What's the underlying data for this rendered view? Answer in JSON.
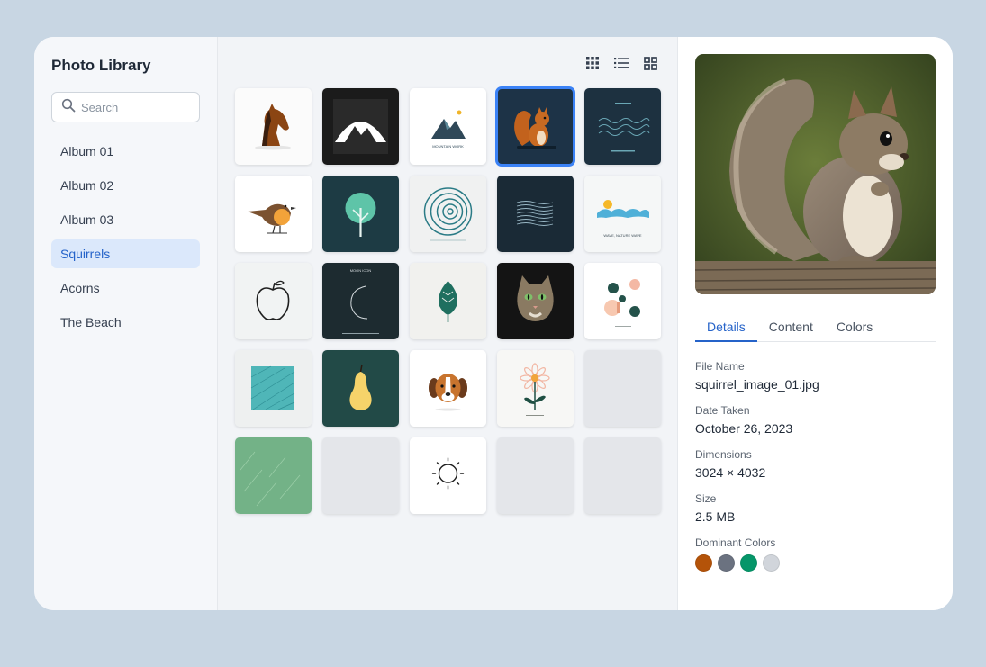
{
  "sidebar": {
    "title": "Photo Library",
    "search_placeholder": "Search",
    "albums": [
      {
        "label": "Album 01",
        "active": false
      },
      {
        "label": "Album 02",
        "active": false
      },
      {
        "label": "Album 03",
        "active": false
      },
      {
        "label": "Squirrels",
        "active": true
      },
      {
        "label": "Acorns",
        "active": false
      },
      {
        "label": "The Beach",
        "active": false
      }
    ]
  },
  "toolbar": {
    "icons": [
      "grid-small-icon",
      "list-icon",
      "grid-large-icon"
    ]
  },
  "grid": {
    "thumbnails": [
      {
        "name": "horse-thumbnail",
        "caption": ""
      },
      {
        "name": "mountain-arch-thumbnail",
        "caption": ""
      },
      {
        "name": "mountain-work-thumbnail",
        "caption": "MOUNTAIN WORK"
      },
      {
        "name": "squirrel-thumbnail",
        "caption": "",
        "selected": true
      },
      {
        "name": "waves-dark-thumbnail",
        "caption": ""
      },
      {
        "name": "bird-thumbnail",
        "caption": ""
      },
      {
        "name": "tree-thumbnail",
        "caption": ""
      },
      {
        "name": "spiral-thumbnail",
        "caption": ""
      },
      {
        "name": "wave-pattern-thumbnail",
        "caption": ""
      },
      {
        "name": "wave-nature-thumbnail",
        "caption": "WAVE, NATURE WAVE"
      },
      {
        "name": "apple-thumbnail",
        "caption": ""
      },
      {
        "name": "moon-icon-thumbnail",
        "caption": "MOON ICON"
      },
      {
        "name": "leaf-thumbnail",
        "caption": ""
      },
      {
        "name": "cat-thumbnail",
        "caption": ""
      },
      {
        "name": "abstract-circles-thumbnail",
        "caption": ""
      },
      {
        "name": "teal-texture-thumbnail",
        "caption": ""
      },
      {
        "name": "pear-thumbnail",
        "caption": ""
      },
      {
        "name": "dog-thumbnail",
        "caption": ""
      },
      {
        "name": "flower-thumbnail",
        "caption": ""
      },
      {
        "name": "empty-thumbnail",
        "caption": ""
      },
      {
        "name": "green-rain-thumbnail",
        "caption": ""
      },
      {
        "name": "empty-thumbnail",
        "caption": ""
      },
      {
        "name": "sun-thumbnail",
        "caption": ""
      },
      {
        "name": "empty-thumbnail",
        "caption": ""
      },
      {
        "name": "empty-thumbnail",
        "caption": ""
      }
    ]
  },
  "detail": {
    "tabs": [
      {
        "label": "Details",
        "active": true
      },
      {
        "label": "Content",
        "active": false
      },
      {
        "label": "Colors",
        "active": false
      }
    ],
    "file_name_label": "File Name",
    "file_name": "squirrel_image_01.jpg",
    "date_label": "Date Taken",
    "date": "October 26, 2023",
    "dimensions_label": "Dimensions",
    "dimensions": "3024 × 4032",
    "size_label": "Size",
    "size": "2.5 MB",
    "dominant_colors_label": "Dominant Colors",
    "dominant_colors": [
      "#b45309",
      "#6b7280",
      "#059669",
      "#d1d5db"
    ]
  },
  "colors": {
    "accent": "#2563c9",
    "active_album_bg": "#dbe8fb",
    "selection": "#3b82f6",
    "background": "#c8d6e3"
  }
}
